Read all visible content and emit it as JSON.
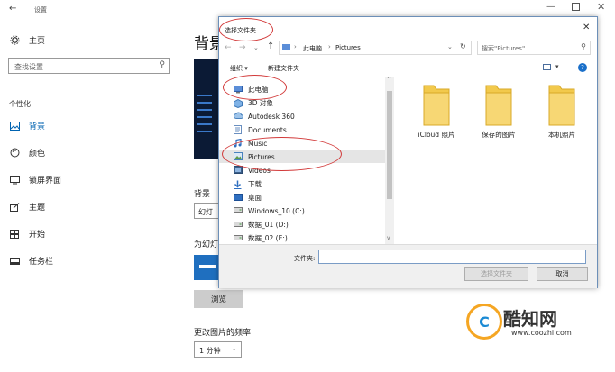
{
  "settings": {
    "window_title": "设置",
    "home": "主页",
    "search_placeholder": "查找设置",
    "section": "个性化",
    "nav": [
      {
        "label": "背景",
        "icon": "image-icon",
        "active": true
      },
      {
        "label": "颜色",
        "icon": "palette-icon"
      },
      {
        "label": "锁屏界面",
        "icon": "lock-screen-icon"
      },
      {
        "label": "主题",
        "icon": "theme-icon"
      },
      {
        "label": "开始",
        "icon": "start-icon"
      },
      {
        "label": "任务栏",
        "icon": "taskbar-icon"
      }
    ],
    "page_title": "背景",
    "bg_label": "背景",
    "bg_value": "幻灯",
    "album_label": "为幻灯",
    "browse_button": "浏览",
    "freq_label": "更改图片的频率",
    "freq_value": "1 分钟"
  },
  "dialog": {
    "title": "选择文件夹",
    "breadcrumb": [
      "此电脑",
      "Pictures"
    ],
    "search_placeholder": "搜索\"Pictures\"",
    "organize": "组织 ▾",
    "new_folder": "新建文件夹",
    "tree": [
      {
        "label": "此电脑",
        "icon": "computer-icon"
      },
      {
        "label": "3D 对象",
        "icon": "3d-objects-icon"
      },
      {
        "label": "Autodesk 360",
        "icon": "cloud-icon"
      },
      {
        "label": "Documents",
        "icon": "documents-icon"
      },
      {
        "label": "Music",
        "icon": "music-icon"
      },
      {
        "label": "Pictures",
        "icon": "pictures-icon",
        "selected": true
      },
      {
        "label": "Videos",
        "icon": "videos-icon"
      },
      {
        "label": "下载",
        "icon": "download-icon"
      },
      {
        "label": "桌面",
        "icon": "desktop-icon"
      },
      {
        "label": "Windows_10 (C:)",
        "icon": "drive-icon"
      },
      {
        "label": "数据_01 (D:)",
        "icon": "drive-icon"
      },
      {
        "label": "数据_02 (E:)",
        "icon": "drive-icon"
      }
    ],
    "folders": [
      "iCloud 照片",
      "保存的图片",
      "本机照片"
    ],
    "folder_label": "文件夹:",
    "folder_value": "",
    "select_button": "选择文件夹",
    "cancel_button": "取消"
  },
  "watermark": {
    "brand": "酷知网",
    "url": "www.coozhi.com"
  },
  "colors": {
    "accent": "#0063b1",
    "selection": "#cce8ff",
    "annotation": "#d23a3a",
    "folder": "#f2c94c"
  }
}
